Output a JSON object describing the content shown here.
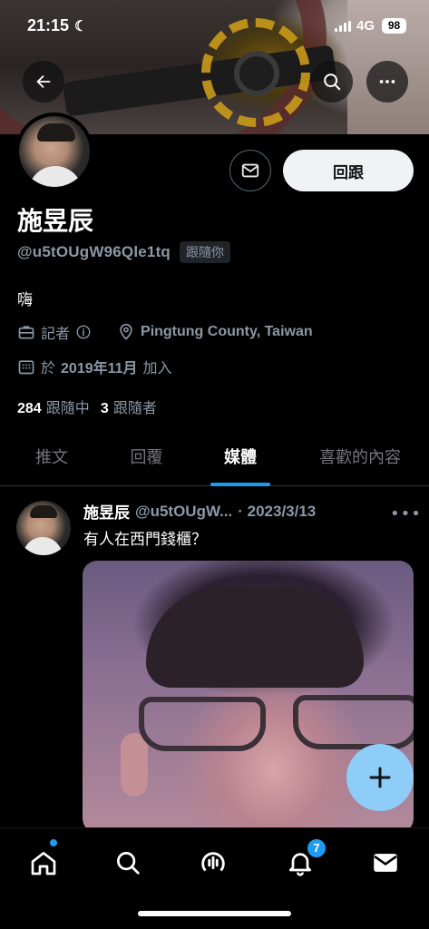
{
  "status_bar": {
    "time": "21:15",
    "network": "4G",
    "battery": "98"
  },
  "profile": {
    "name": "施昱辰",
    "handle": "@u5tOUgW96Qle1tq",
    "follows_you": "跟隨你",
    "bio": "嗨",
    "occupation": "記者",
    "location": "Pingtung County, Taiwan",
    "joined_prefix": "於",
    "joined_date": "2019年11月",
    "joined_suffix": "加入",
    "following_count": "284",
    "following_label": "跟隨中",
    "followers_count": "3",
    "followers_label": "跟隨者",
    "follow_button": "回跟"
  },
  "tabs": [
    {
      "label": "推文",
      "active": false
    },
    {
      "label": "回覆",
      "active": false
    },
    {
      "label": "媒體",
      "active": true
    },
    {
      "label": "喜歡的內容",
      "active": false
    }
  ],
  "tweet": {
    "author": "施昱辰",
    "handle": "@u5tOUgW...",
    "date": "· 2023/3/13",
    "text": "有人在西門錢櫃？"
  },
  "bottom_nav": {
    "items": [
      "home-icon",
      "search-icon",
      "spaces-icon",
      "bell-icon",
      "mail-icon"
    ],
    "notifications_badge": "7"
  },
  "colors": {
    "accent": "#1d9bf0",
    "fab": "#8ecdf8",
    "background": "#000000",
    "secondary_text": "#8b98a5"
  }
}
